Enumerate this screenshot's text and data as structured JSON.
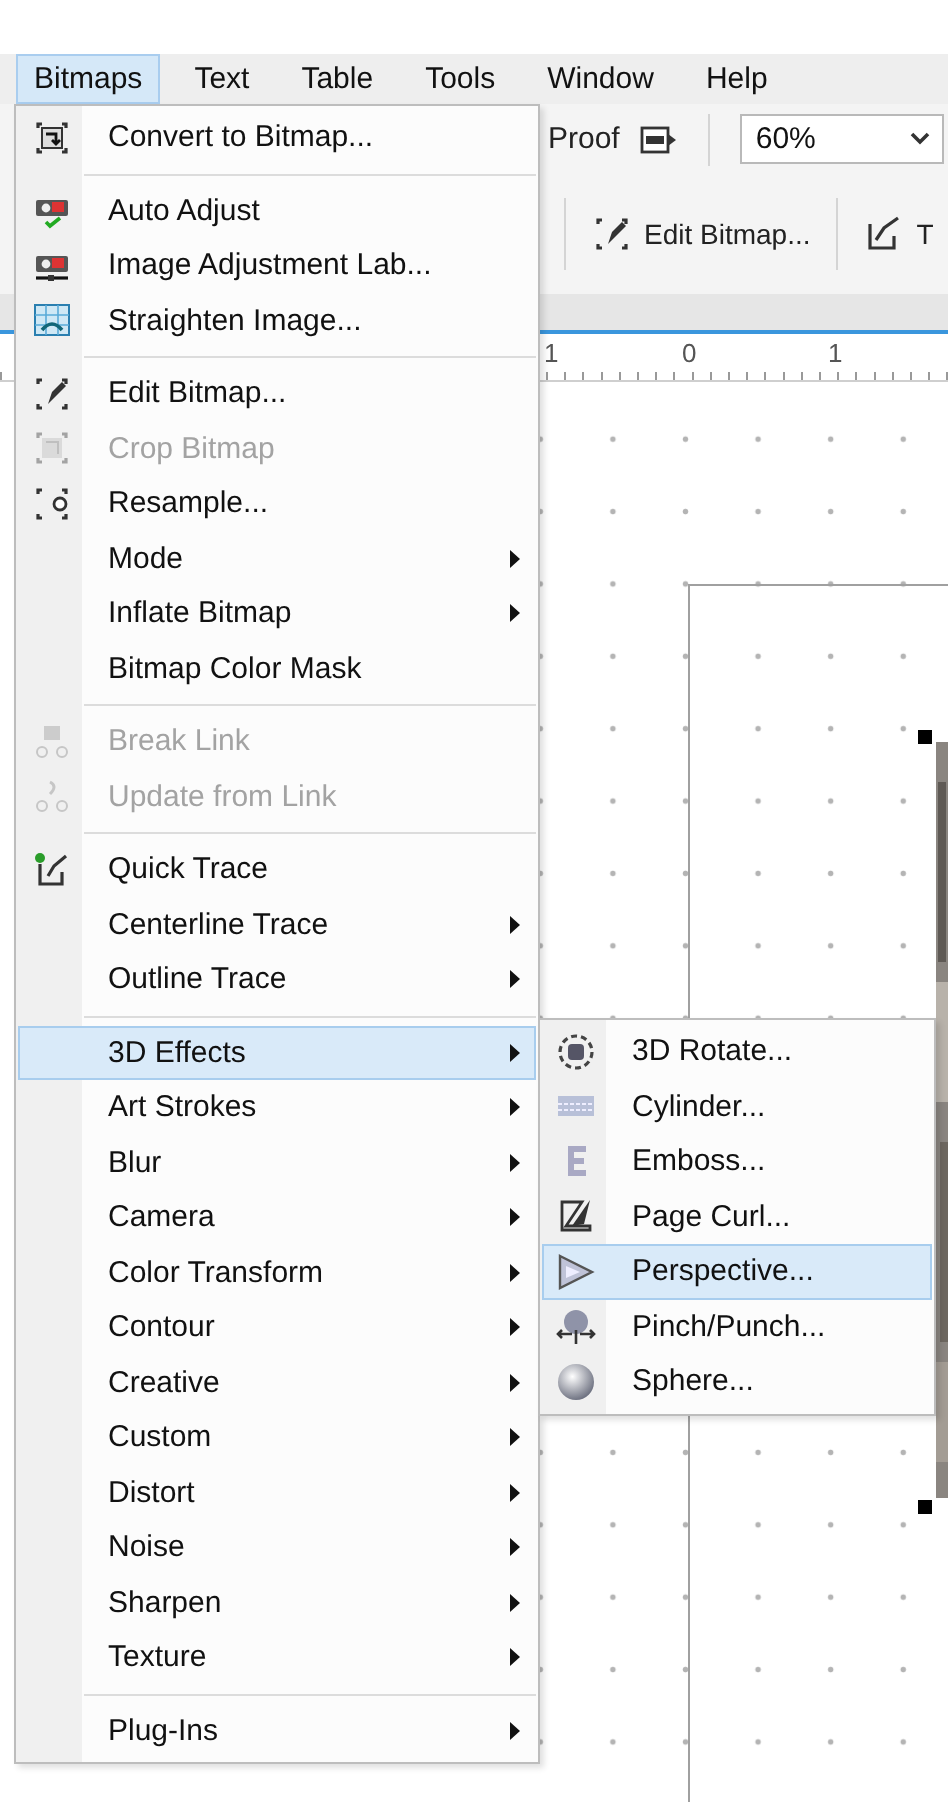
{
  "menu_bar": [
    {
      "label": "Bitmaps",
      "selected": true
    },
    {
      "label": "Text",
      "selected": false
    },
    {
      "label": "Table",
      "selected": false
    },
    {
      "label": "Tools",
      "selected": false
    },
    {
      "label": "Window",
      "selected": false
    },
    {
      "label": "Help",
      "selected": false
    }
  ],
  "toolbar": {
    "proof_label": "Proof",
    "zoom_value": "60%"
  },
  "property_bar": {
    "edit_bitmap_button": "Edit Bitmap...",
    "next_button": "T"
  },
  "ruler": {
    "labels": [
      "1",
      "0",
      "1"
    ]
  },
  "bitmaps_menu": {
    "groups": [
      [
        {
          "label": "Convert to Bitmap...",
          "disabled": false,
          "submenu": false,
          "selected": false
        }
      ],
      [
        {
          "label": "Auto Adjust",
          "disabled": false,
          "submenu": false,
          "selected": false
        },
        {
          "label": "Image Adjustment Lab...",
          "disabled": false,
          "submenu": false,
          "selected": false
        },
        {
          "label": "Straighten Image...",
          "disabled": false,
          "submenu": false,
          "selected": false
        }
      ],
      [
        {
          "label": "Edit Bitmap...",
          "disabled": false,
          "submenu": false,
          "selected": false
        },
        {
          "label": "Crop Bitmap",
          "disabled": true,
          "submenu": false,
          "selected": false
        },
        {
          "label": "Resample...",
          "disabled": false,
          "submenu": false,
          "selected": false
        },
        {
          "label": "Mode",
          "disabled": false,
          "submenu": true,
          "selected": false
        },
        {
          "label": "Inflate Bitmap",
          "disabled": false,
          "submenu": true,
          "selected": false
        },
        {
          "label": "Bitmap Color Mask",
          "disabled": false,
          "submenu": false,
          "selected": false
        }
      ],
      [
        {
          "label": "Break Link",
          "disabled": true,
          "submenu": false,
          "selected": false
        },
        {
          "label": "Update from Link",
          "disabled": true,
          "submenu": false,
          "selected": false
        }
      ],
      [
        {
          "label": "Quick Trace",
          "disabled": false,
          "submenu": false,
          "selected": false
        },
        {
          "label": "Centerline Trace",
          "disabled": false,
          "submenu": true,
          "selected": false
        },
        {
          "label": "Outline Trace",
          "disabled": false,
          "submenu": true,
          "selected": false
        }
      ],
      [
        {
          "label": "3D Effects",
          "disabled": false,
          "submenu": true,
          "selected": true
        },
        {
          "label": "Art Strokes",
          "disabled": false,
          "submenu": true,
          "selected": false
        },
        {
          "label": "Blur",
          "disabled": false,
          "submenu": true,
          "selected": false
        },
        {
          "label": "Camera",
          "disabled": false,
          "submenu": true,
          "selected": false
        },
        {
          "label": "Color Transform",
          "disabled": false,
          "submenu": true,
          "selected": false
        },
        {
          "label": "Contour",
          "disabled": false,
          "submenu": true,
          "selected": false
        },
        {
          "label": "Creative",
          "disabled": false,
          "submenu": true,
          "selected": false
        },
        {
          "label": "Custom",
          "disabled": false,
          "submenu": true,
          "selected": false
        },
        {
          "label": "Distort",
          "disabled": false,
          "submenu": true,
          "selected": false
        },
        {
          "label": "Noise",
          "disabled": false,
          "submenu": true,
          "selected": false
        },
        {
          "label": "Sharpen",
          "disabled": false,
          "submenu": true,
          "selected": false
        },
        {
          "label": "Texture",
          "disabled": false,
          "submenu": true,
          "selected": false
        }
      ],
      [
        {
          "label": "Plug-Ins",
          "disabled": false,
          "submenu": true,
          "selected": false
        }
      ]
    ]
  },
  "effects_submenu": {
    "items": [
      {
        "label": "3D Rotate...",
        "selected": false
      },
      {
        "label": "Cylinder...",
        "selected": false
      },
      {
        "label": "Emboss...",
        "selected": false
      },
      {
        "label": "Page Curl...",
        "selected": false
      },
      {
        "label": "Perspective...",
        "selected": true
      },
      {
        "label": "Pinch/Punch...",
        "selected": false
      },
      {
        "label": "Sphere...",
        "selected": false
      }
    ]
  }
}
